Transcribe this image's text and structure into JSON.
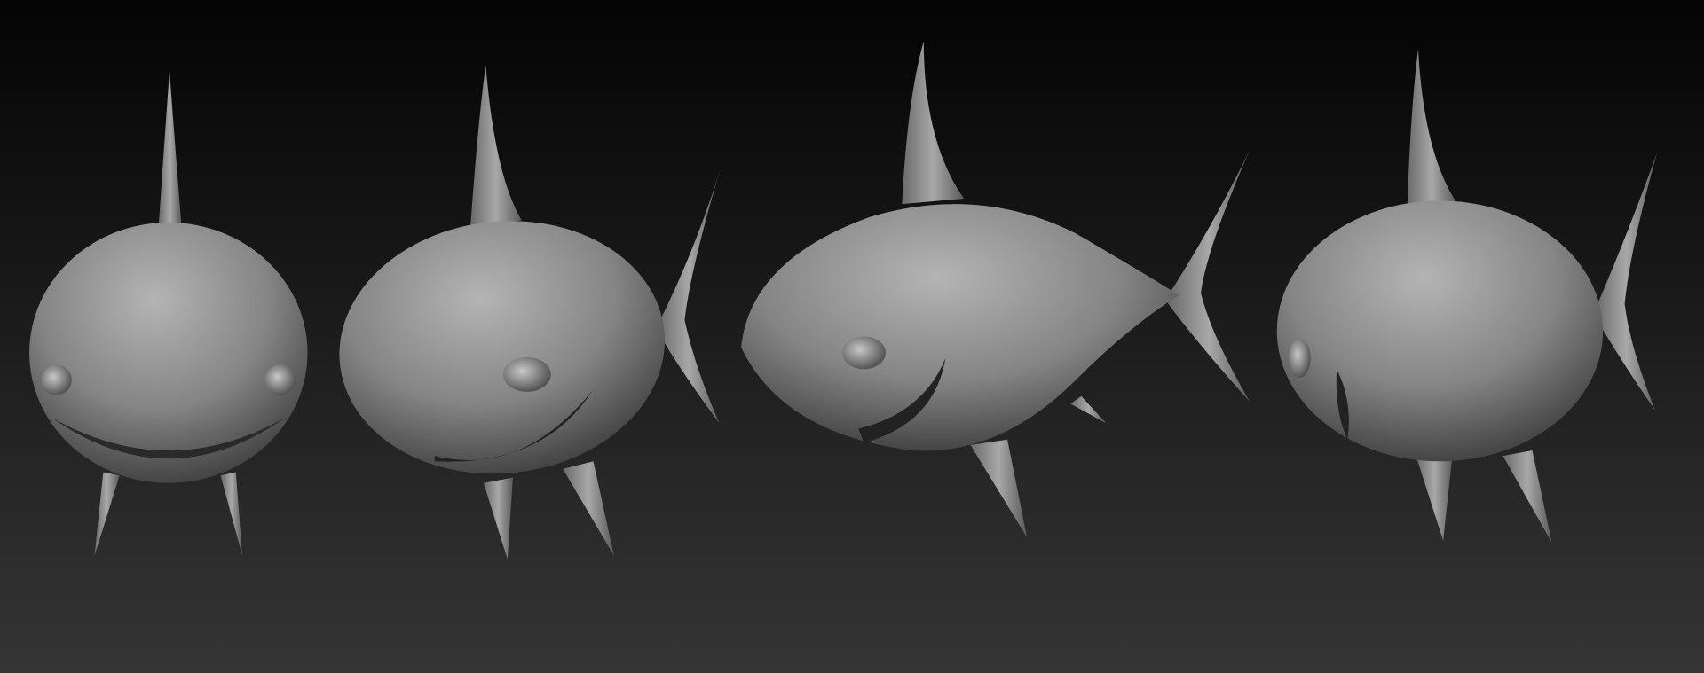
{
  "scene": {
    "background_top": "#040404",
    "background_bottom": "#353535",
    "material_light": "#b4b4b4",
    "material_mid": "#858585",
    "material_dark": "#3a3a3a",
    "subjects": [
      "shark-front-view",
      "shark-three-quarter-view",
      "shark-side-view",
      "shark-rear-three-quarter-view"
    ]
  }
}
